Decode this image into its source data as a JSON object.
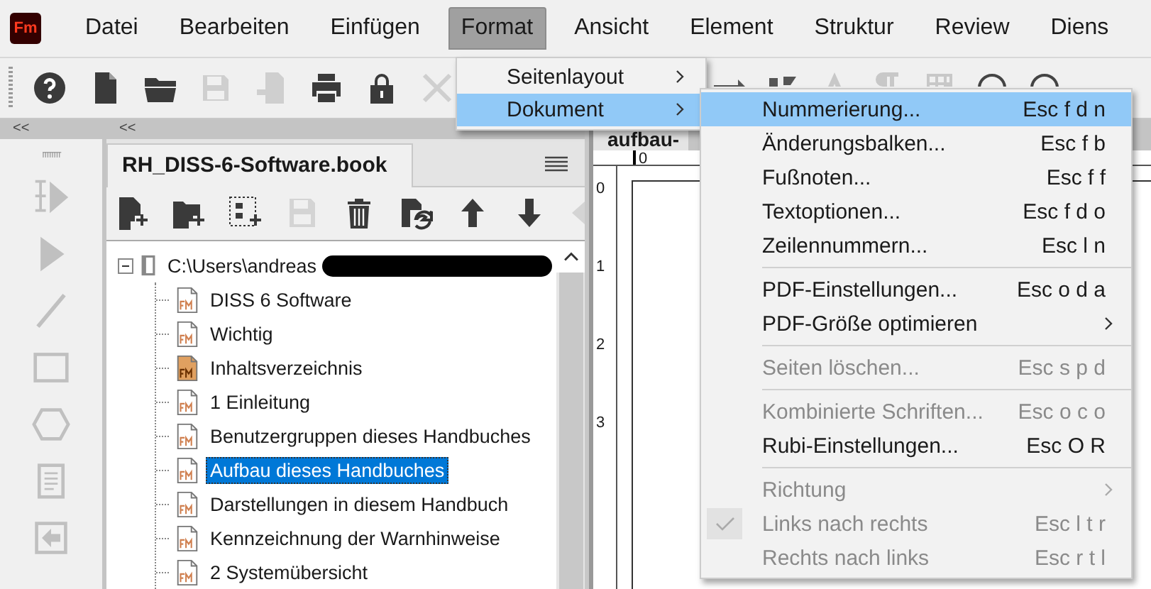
{
  "app": {
    "logo": "Fm"
  },
  "menubar": [
    {
      "label": "Datei",
      "selected": false
    },
    {
      "label": "Bearbeiten",
      "selected": false
    },
    {
      "label": "Einfügen",
      "selected": false
    },
    {
      "label": "Format",
      "selected": true
    },
    {
      "label": "Ansicht",
      "selected": false
    },
    {
      "label": "Element",
      "selected": false
    },
    {
      "label": "Struktur",
      "selected": false
    },
    {
      "label": "Review",
      "selected": false
    },
    {
      "label": "Diens",
      "selected": false
    }
  ],
  "toolbar": [
    {
      "disabled": false
    },
    {
      "disabled": false
    },
    {
      "disabled": false
    },
    {
      "disabled": true
    },
    {
      "disabled": true
    },
    {
      "disabled": false
    },
    {
      "disabled": false
    },
    {
      "disabled": true
    }
  ],
  "tools_panel": {
    "collapse": "<<"
  },
  "book_panel": {
    "collapse": "<<",
    "tab": "RH_DISS-6-Software.book",
    "toolbar": [
      {
        "disabled": false
      },
      {
        "disabled": false
      },
      {
        "disabled": false
      },
      {
        "disabled": true
      },
      {
        "disabled": false
      },
      {
        "disabled": false
      },
      {
        "disabled": false
      },
      {
        "disabled": false
      },
      {
        "disabled": true
      }
    ],
    "tree": [
      {
        "label": "C:\\Users\\andreas",
        "kind": "book",
        "expanded": true,
        "selected": false,
        "children": [
          {
            "label": "DISS 6 Software",
            "kind": "file",
            "selected": false
          },
          {
            "label": "Wichtig",
            "kind": "file",
            "selected": false
          },
          {
            "label": "Inhaltsverzeichnis",
            "kind": "generated",
            "selected": false
          },
          {
            "label": "1 Einleitung",
            "kind": "file",
            "selected": false
          },
          {
            "label": "Benutzergruppen dieses Handbuches",
            "kind": "file",
            "selected": false
          },
          {
            "label": "Aufbau dieses Handbuches",
            "kind": "file",
            "selected": true
          },
          {
            "label": "Darstellungen in diesem Handbuch",
            "kind": "file",
            "selected": false
          },
          {
            "label": "Kennzeichnung der Warnhinweise",
            "kind": "file",
            "selected": false
          },
          {
            "label": "2 Systemübersicht",
            "kind": "file",
            "selected": false
          }
        ]
      }
    ]
  },
  "document": {
    "tab": "aufbau-",
    "top_ruler": [
      "0"
    ],
    "side_ruler": [
      "0",
      "1",
      "2",
      "3"
    ]
  },
  "format_menu": [
    {
      "label": "Seitenlayout",
      "submenu": true,
      "selected": false
    },
    {
      "label": "Dokument",
      "submenu": true,
      "selected": true
    }
  ],
  "document_menu": [
    [
      {
        "label": "Nummerierung...",
        "shortcut": "Esc f d n",
        "selected": true,
        "disabled": false,
        "checked": false,
        "submenu": false
      },
      {
        "label": "Änderungsbalken...",
        "shortcut": "Esc f b",
        "selected": false,
        "disabled": false,
        "checked": false,
        "submenu": false
      },
      {
        "label": "Fußnoten...",
        "shortcut": "Esc f f",
        "selected": false,
        "disabled": false,
        "checked": false,
        "submenu": false
      },
      {
        "label": "Textoptionen...",
        "shortcut": "Esc f d o",
        "selected": false,
        "disabled": false,
        "checked": false,
        "submenu": false
      },
      {
        "label": "Zeilennummern...",
        "shortcut": "Esc l n",
        "selected": false,
        "disabled": false,
        "checked": false,
        "submenu": false
      }
    ],
    [
      {
        "label": "PDF-Einstellungen...",
        "shortcut": "Esc o d a",
        "selected": false,
        "disabled": false,
        "checked": false,
        "submenu": false
      },
      {
        "label": "PDF-Größe optimieren",
        "selected": false,
        "disabled": false,
        "checked": false,
        "submenu": true
      }
    ],
    [
      {
        "label": "Seiten löschen...",
        "shortcut": "Esc s p d",
        "selected": false,
        "disabled": true,
        "checked": false,
        "submenu": false
      }
    ],
    [
      {
        "label": "Kombinierte Schriften...",
        "shortcut": "Esc o c o",
        "selected": false,
        "disabled": true,
        "checked": false,
        "submenu": false
      },
      {
        "label": "Rubi-Einstellungen...",
        "shortcut": "Esc O R",
        "selected": false,
        "disabled": false,
        "checked": false,
        "submenu": false
      }
    ],
    [
      {
        "label": "Richtung",
        "selected": false,
        "disabled": true,
        "checked": false,
        "submenu": true
      },
      {
        "label": "Links nach rechts",
        "shortcut": "Esc l t r",
        "selected": false,
        "disabled": true,
        "checked": true,
        "submenu": false
      },
      {
        "label": "Rechts nach links",
        "shortcut": "Esc r t l",
        "selected": false,
        "disabled": true,
        "checked": false,
        "submenu": false
      }
    ]
  ]
}
